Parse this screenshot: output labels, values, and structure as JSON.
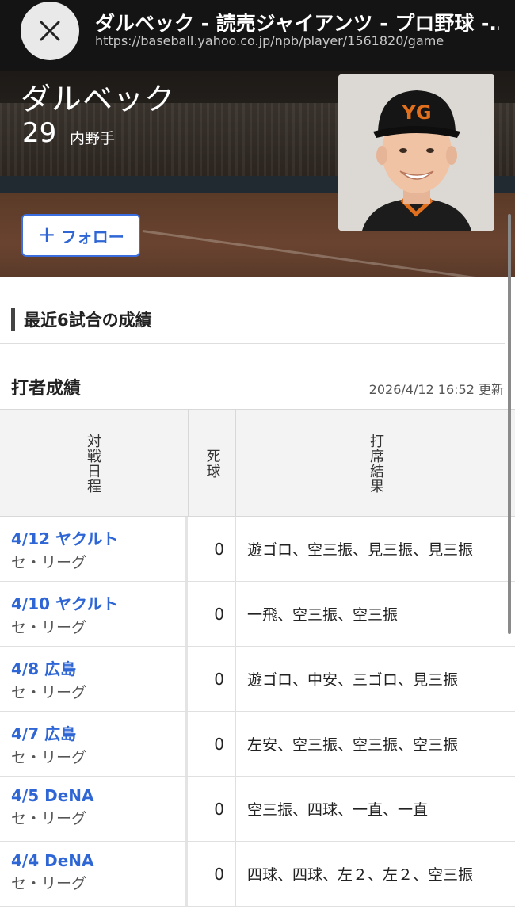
{
  "browser": {
    "title": "ダルベック - 読売ジャイアンツ - プロ野球 -...",
    "url": "https://baseball.yahoo.co.jp/npb/player/1561820/game"
  },
  "player": {
    "name": "ダルベック",
    "number": "29",
    "position": "内野手",
    "follow_label": "フォロー"
  },
  "section": {
    "title": "最近6試合の成績"
  },
  "batting": {
    "title": "打者成績",
    "updated": "2026/4/12 16:52 更新",
    "headers": {
      "date": "対戦日程",
      "hbp": "死球",
      "result": "打席結果"
    },
    "rows": [
      {
        "game": "4/12 ヤクルト",
        "league": "セ・リーグ",
        "hbp": "0",
        "result": "遊ゴロ、空三振、見三振、見三振"
      },
      {
        "game": "4/10 ヤクルト",
        "league": "セ・リーグ",
        "hbp": "0",
        "result": "一飛、空三振、空三振"
      },
      {
        "game": "4/8 広島",
        "league": "セ・リーグ",
        "hbp": "0",
        "result": "遊ゴロ、中安、三ゴロ、見三振"
      },
      {
        "game": "4/7 広島",
        "league": "セ・リーグ",
        "hbp": "0",
        "result": "左安、空三振、空三振、空三振"
      },
      {
        "game": "4/5 DeNA",
        "league": "セ・リーグ",
        "hbp": "0",
        "result": "空三振、四球、一直、一直"
      },
      {
        "game": "4/4 DeNA",
        "league": "セ・リーグ",
        "hbp": "0",
        "result": "四球、四球、左２、左２、空三振"
      }
    ]
  },
  "colors": {
    "link": "#2f66d6",
    "topbar": "#141414"
  }
}
